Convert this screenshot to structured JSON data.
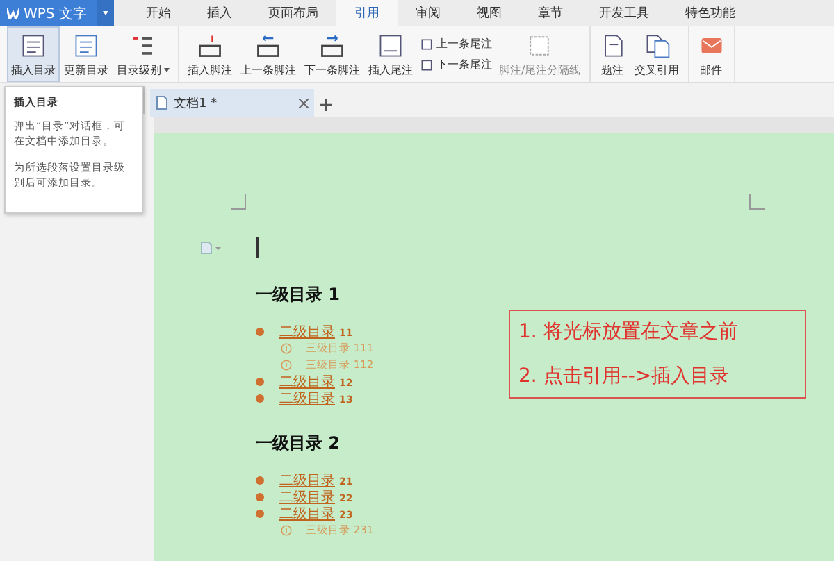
{
  "app": {
    "logo": "WPS 文字"
  },
  "menu_tabs": [
    {
      "label": "开始",
      "selected": false
    },
    {
      "label": "插入",
      "selected": false
    },
    {
      "label": "页面布局",
      "selected": false
    },
    {
      "label": "引用",
      "selected": true
    },
    {
      "label": "审阅",
      "selected": false
    },
    {
      "label": "视图",
      "selected": false
    },
    {
      "label": "章节",
      "selected": false
    },
    {
      "label": "开发工具",
      "selected": false
    },
    {
      "label": "特色功能",
      "selected": false
    }
  ],
  "ribbon_groups": [
    {
      "items": [
        {
          "kind": "large",
          "label": "插入目录",
          "selected": true,
          "disabled": false
        },
        {
          "kind": "large",
          "label": "更新目录",
          "selected": false,
          "disabled": false
        },
        {
          "kind": "large",
          "label": "目录级别",
          "selected": false,
          "disabled": false,
          "dropdown": true
        }
      ]
    },
    {
      "items": [
        {
          "kind": "large",
          "label": "插入脚注",
          "selected": false,
          "disabled": false
        },
        {
          "kind": "large",
          "label": "上一条脚注",
          "selected": false,
          "disabled": false
        },
        {
          "kind": "large",
          "label": "下一条脚注",
          "selected": false,
          "disabled": false
        },
        {
          "kind": "large",
          "label": "插入尾注",
          "selected": false,
          "disabled": false
        },
        {
          "kind": "small",
          "label": "上一条尾注",
          "selected": false,
          "disabled": false
        },
        {
          "kind": "small",
          "label": "下一条尾注",
          "selected": false,
          "disabled": false
        },
        {
          "kind": "large",
          "label": "脚注/尾注分隔线",
          "selected": false,
          "disabled": true
        }
      ]
    },
    {
      "items": [
        {
          "kind": "large",
          "label": "题注",
          "selected": false,
          "disabled": false
        },
        {
          "kind": "large",
          "label": "交叉引用",
          "selected": false,
          "disabled": false
        }
      ]
    },
    {
      "items": [
        {
          "kind": "large",
          "label": "邮件",
          "selected": false,
          "disabled": false
        }
      ]
    }
  ],
  "doc_tabs": [
    {
      "label": "文档1 *",
      "selected": true
    }
  ],
  "tooltip": {
    "title": "插入目录",
    "paragraphs": [
      "弹出“目录”对话框，可在文档中添加目录。",
      "为所选段落设置目录级别后可添加目录。"
    ]
  },
  "document": {
    "sections": [
      {
        "heading": "一级目录 1",
        "children": [
          {
            "text": "二级目录",
            "number": "11",
            "children": [
              {
                "text": "三级目录",
                "number": "111"
              },
              {
                "text": "三级目录",
                "number": "112"
              }
            ]
          },
          {
            "text": "二级目录",
            "number": "12"
          },
          {
            "text": "二级目录",
            "number": "13"
          }
        ]
      },
      {
        "heading": "一级目录 2",
        "children": [
          {
            "text": "二级目录",
            "number": "21"
          },
          {
            "text": "二级目录",
            "number": "22"
          },
          {
            "text": "二级目录",
            "number": "23",
            "children": [
              {
                "text": "三级目录",
                "number": "231"
              }
            ]
          }
        ]
      }
    ],
    "callout": [
      "1. 将光标放置在文章之前",
      "2. 点击引用-->插入目录"
    ]
  }
}
